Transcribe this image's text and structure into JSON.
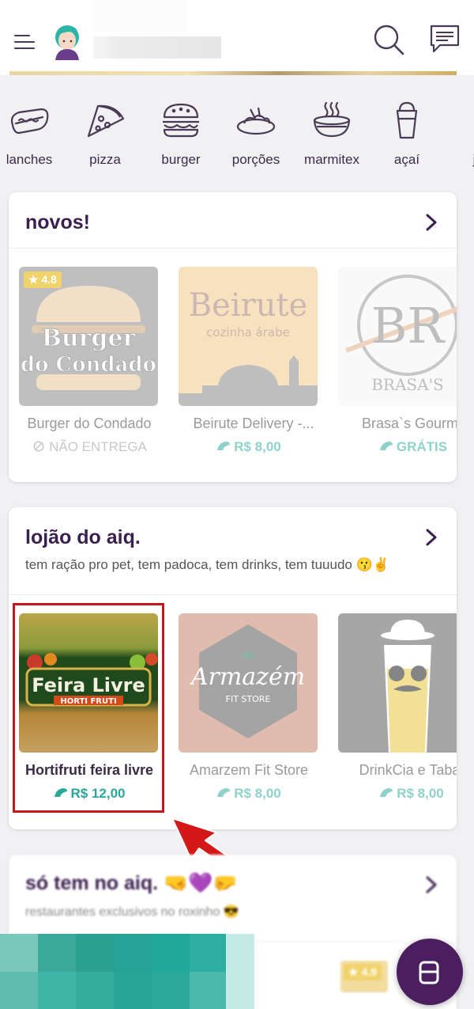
{
  "header": {
    "menu_icon": "hamburger-menu-icon",
    "avatar": "user-avatar",
    "search_icon": "search-icon",
    "chat_icon": "chat-icon"
  },
  "categories": [
    {
      "label": "lanches",
      "icon": "hotdog-icon"
    },
    {
      "label": "pizza",
      "icon": "pizza-slice-icon"
    },
    {
      "label": "burger",
      "icon": "burger-icon"
    },
    {
      "label": "porções",
      "icon": "portion-plate-icon"
    },
    {
      "label": "marmitex",
      "icon": "pot-icon"
    },
    {
      "label": "açaí",
      "icon": "acai-cup-icon"
    },
    {
      "label": "jap",
      "icon": "japanese-bowl-icon"
    }
  ],
  "novos": {
    "title": "novos!",
    "stores": [
      {
        "name": "Burger do Condado",
        "fee": "NÃO ENTREGA",
        "rating": "4.8",
        "logo_text_1": "Burger",
        "logo_text_2": "do Condado"
      },
      {
        "name": "Beirute Delivery -...",
        "fee": "R$ 8,00",
        "logo_text_1": "Beirute",
        "logo_text_2": "cozinha árabe"
      },
      {
        "name": "Brasa`s Gourme",
        "fee": "GRÁTIS",
        "logo_text_1": "BR",
        "logo_text_2": "BRASA'S"
      }
    ]
  },
  "lojao": {
    "title": "lojão do aiq.",
    "subtitle": "tem ração pro pet, tem padoca, tem drinks, tem tuuudo 😗✌",
    "stores": [
      {
        "name": "Hortifruti feira livre",
        "fee": "R$ 12,00",
        "logo_text_1": "Feira Livre",
        "logo_text_2": "HORTI FRUTI"
      },
      {
        "name": "Amarzem Fit Store",
        "fee": "R$ 8,00",
        "logo_text_1": "Armazém",
        "logo_text_2": "FIT STORE"
      },
      {
        "name": "DrinkCia e Tabac",
        "fee": "R$ 8,00"
      }
    ]
  },
  "so_tem": {
    "title": "só tem no aiq. 🤜💜🤛",
    "subtitle": "restaurantes exclusivos no roxinho 😎",
    "rating": "4.9"
  },
  "colors": {
    "brand_purple": "#4b1f5f",
    "fee_teal": "#2aa79b",
    "highlight_red": "#c6161e"
  }
}
